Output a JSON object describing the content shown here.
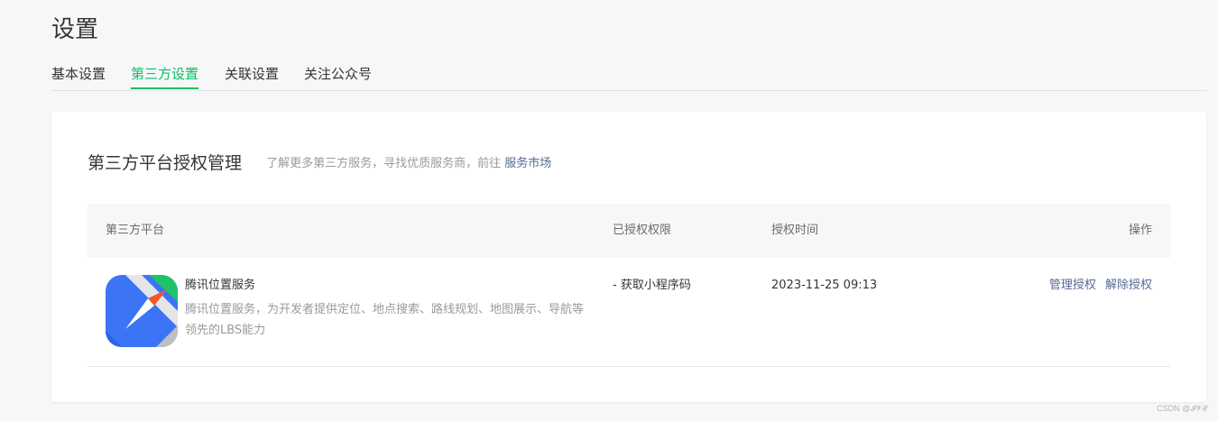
{
  "page": {
    "title": "设置"
  },
  "tabs": [
    {
      "label": "基本设置",
      "active": false
    },
    {
      "label": "第三方设置",
      "active": true
    },
    {
      "label": "关联设置",
      "active": false
    },
    {
      "label": "关注公众号",
      "active": false
    }
  ],
  "card": {
    "title": "第三方平台授权管理",
    "desc_prefix": "了解更多第三方服务，寻找优质服务商，前往",
    "market_link": "服务市场"
  },
  "table": {
    "columns": {
      "platform": "第三方平台",
      "permissions": "已授权权限",
      "auth_time": "授权时间",
      "actions": "操作"
    },
    "rows": [
      {
        "logo_icon": "tencent-location-icon",
        "name": "腾讯位置服务",
        "desc": "腾讯位置服务，为开发者提供定位、地点搜索、路线规划、地图展示、导航等领先的LBS能力",
        "permission": "- 获取小程序码",
        "auth_time": "2023-11-25 09:13",
        "actions": [
          "管理授权",
          "解除授权"
        ]
      }
    ]
  },
  "watermark": "CSDN @𝓘𝓥𝓔",
  "colors": {
    "accent_green": "#07c160",
    "link_blue": "#576b95",
    "background": "#f6f7f9"
  }
}
